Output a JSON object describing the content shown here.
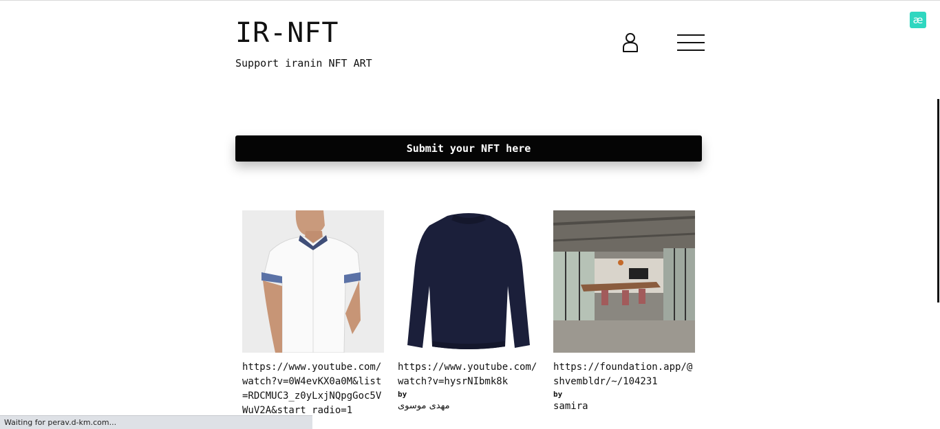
{
  "header": {
    "title": "IR-NFT",
    "tagline": "Support iranin NFT ART",
    "user_icon": "user-icon",
    "menu_icon": "hamburger-menu-icon"
  },
  "extension_badge": {
    "label": "æ",
    "color": "#2fd7c0"
  },
  "submit": {
    "label": "Submit your NFT here"
  },
  "cards": [
    {
      "image": "white-shirt-photo",
      "link": "https://www.youtube.com/watch?v=0W4evKX0a0M&list=RDCMUC3_z0yLxjNQpgGoc5VWuV2A&start_radio=1",
      "by_label": "",
      "author": ""
    },
    {
      "image": "navy-sweater-photo",
      "link": "https://www.youtube.com/watch?v=hysrNIbmk8k",
      "by_label": "by",
      "author": "مهدی موسوی"
    },
    {
      "image": "office-interior-photo",
      "link": "https://foundation.app/@shvembldr/~/104231",
      "by_label": "by",
      "author": "samira"
    }
  ],
  "status": {
    "text": "Waiting for perav.d-km.com..."
  },
  "colors": {
    "button_bg": "#050505",
    "badge": "#2fd7c0",
    "status_bg": "#dee1e6"
  }
}
